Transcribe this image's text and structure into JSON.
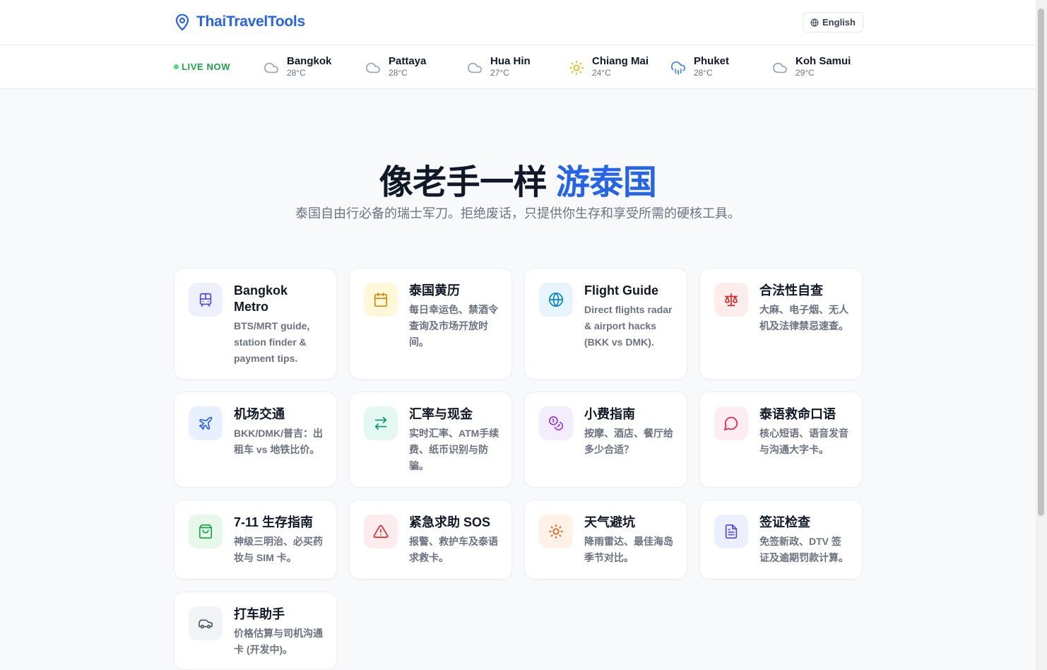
{
  "header": {
    "brand": "ThaiTravelTools",
    "language": "English"
  },
  "weather": {
    "live_label": "LIVE NOW",
    "cities": [
      {
        "name": "Bangkok",
        "temp": "28°C",
        "icon": "cloud-icon"
      },
      {
        "name": "Pattaya",
        "temp": "28°C",
        "icon": "cloud-icon"
      },
      {
        "name": "Hua Hin",
        "temp": "27°C",
        "icon": "cloud-icon"
      },
      {
        "name": "Chiang Mai",
        "temp": "24°C",
        "icon": "sun-icon"
      },
      {
        "name": "Phuket",
        "temp": "28°C",
        "icon": "cloud-rain-icon"
      },
      {
        "name": "Koh Samui",
        "temp": "29°C",
        "icon": "cloud-icon"
      }
    ]
  },
  "hero": {
    "title_main": "像老手一样 ",
    "title_accent": "游泰国",
    "subtitle": "泰国自由行必备的瑞士军刀。拒绝废话，只提供你生存和享受所需的硬核工具。"
  },
  "colors": {
    "brand": "#2563eb",
    "live": "#22a04b"
  },
  "tools": [
    {
      "title": "Bangkok Metro",
      "desc": "BTS/MRT guide, station finder & payment tips.",
      "icon": "train-icon",
      "bg": "#eef0fd",
      "fg": "#4f46e5"
    },
    {
      "title": "泰国黄历",
      "desc": "每日幸运色、禁酒令查询及市场开放时间。",
      "icon": "calendar-icon",
      "bg": "#fef7d8",
      "fg": "#ca8a04"
    },
    {
      "title": "Flight Guide",
      "desc": "Direct flights radar & airport hacks (BKK vs DMK).",
      "icon": "globe-icon",
      "bg": "#e7f4fd",
      "fg": "#0284c7"
    },
    {
      "title": "合法性自查",
      "desc": "大麻、电子烟、无人机及法律禁忌速查。",
      "icon": "scale-icon",
      "bg": "#fdecec",
      "fg": "#dc2626"
    },
    {
      "title": "机场交通",
      "desc": "BKK/DMK/普吉：出租车 vs 地铁比价。",
      "icon": "plane-icon",
      "bg": "#e8efff",
      "fg": "#2563eb"
    },
    {
      "title": "汇率与现金",
      "desc": "实时汇率、ATM手续费、纸币识别与防骗。",
      "icon": "exchange-icon",
      "bg": "#e3f8f1",
      "fg": "#059669"
    },
    {
      "title": "小费指南",
      "desc": "按摩、酒店、餐厅给多少合适？",
      "icon": "coins-icon",
      "bg": "#f3edfe",
      "fg": "#9333ea"
    },
    {
      "title": "泰语救命口语",
      "desc": "核心短语、语音发音与沟通大字卡。",
      "icon": "chat-icon",
      "bg": "#fdecf1",
      "fg": "#e11d48"
    },
    {
      "title": "7-11 生存指南",
      "desc": "神级三明治、必买药妆与 SIM 卡。",
      "icon": "shopping-bag-icon",
      "bg": "#e5f8ea",
      "fg": "#16a34a"
    },
    {
      "title": "紧急求助 SOS",
      "desc": "报警、救护车及泰语求救卡。",
      "icon": "warning-icon",
      "bg": "#fdecee",
      "fg": "#dc2626"
    },
    {
      "title": "天气避坑",
      "desc": "降雨雷达、最佳海岛季节对比。",
      "icon": "sun-icon",
      "bg": "#fff1e5",
      "fg": "#ea580c"
    },
    {
      "title": "签证检查",
      "desc": "免签新政、DTV 签证及逾期罚款计算。",
      "icon": "document-icon",
      "bg": "#eceffd",
      "fg": "#4f46e5"
    },
    {
      "title": "打车助手",
      "desc": "价格估算与司机沟通卡 (开发中)。",
      "icon": "car-icon",
      "bg": "#f2f3f5",
      "fg": "#4b5563"
    }
  ]
}
